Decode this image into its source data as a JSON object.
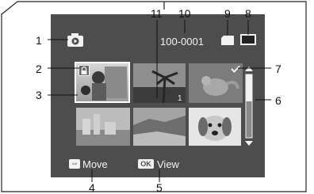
{
  "callouts": {
    "n1": "1",
    "n2": "2",
    "n3": "3",
    "n4": "4",
    "n5": "5",
    "n6": "6",
    "n7": "7",
    "n8": "8",
    "n9": "9",
    "n10": "10",
    "n11": "11"
  },
  "screen": {
    "file_number": "100-0001",
    "burst_count": "1",
    "footer": {
      "move_icon": "⇔",
      "move_label": "Move",
      "ok_icon": "OK",
      "view_label": "View"
    }
  },
  "icons": {
    "playback": "playback-mode-icon",
    "protect": "protect-lock-icon",
    "memory": "memory-card-icon",
    "battery": "battery-icon",
    "check": "print-check-icon"
  },
  "colors": {
    "lcd_background": "#4d4d4d",
    "selection_frame": "#ffffff",
    "text": "#f2f2f2"
  }
}
